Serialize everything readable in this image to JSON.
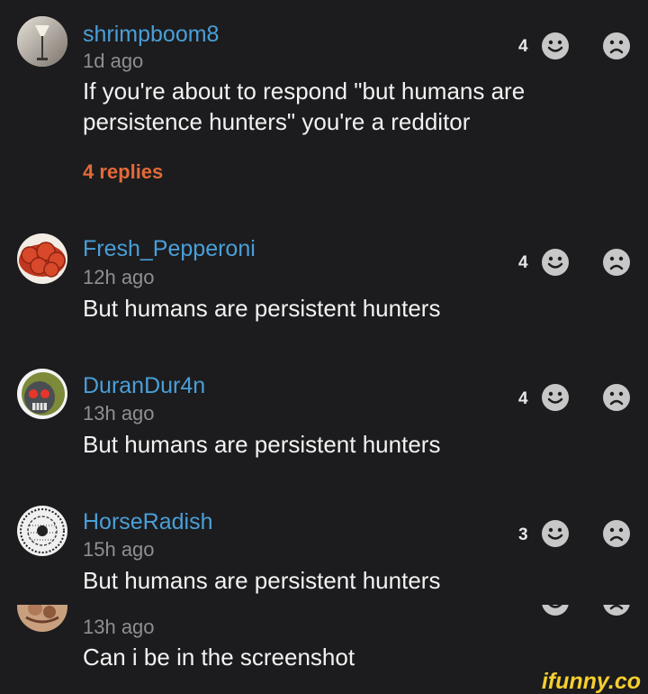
{
  "comments": [
    {
      "username": "shrimpboom8",
      "time": "1d ago",
      "text": "If you're about to respond \"but humans are persistence hunters\" you're a redditor",
      "replies": "4 replies",
      "likes": "4",
      "avatar": "avatar-lamp"
    },
    {
      "username": "Fresh_Pepperoni",
      "time": "12h ago",
      "text": "But humans are persistent hunters",
      "likes": "4",
      "avatar": "avatar-pepperoni"
    },
    {
      "username": "DuranDur4n",
      "time": "13h ago",
      "text": "But humans are persistent hunters",
      "likes": "4",
      "avatar": "avatar-monkey"
    },
    {
      "username": "HorseRadish",
      "time": "15h ago",
      "text": "But humans are persistent hunters",
      "likes": "3",
      "avatar": "avatar-sketch"
    },
    {
      "time": "13h ago",
      "text": "Can i be in the screenshot"
    }
  ],
  "icons": {
    "like": "smile-icon",
    "dislike": "sad-icon"
  },
  "colors": {
    "background": "#1c1c1e",
    "username": "#4a9fd8",
    "replies": "#e26a3a",
    "icon": "#c7c7c7"
  },
  "watermark": "ifunny.co"
}
